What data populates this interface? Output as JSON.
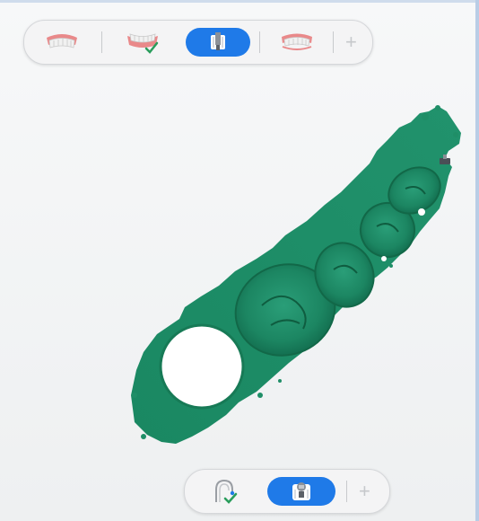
{
  "colors": {
    "accent": "#1f7ae8",
    "model": "#1f8e67",
    "toolbar_bg": "#f4f4f5",
    "check": "#2a9d5c"
  },
  "top_toolbar": {
    "buttons": [
      {
        "icon": "upper-jaw-teeth-icon",
        "active": false
      },
      {
        "icon": "lower-jaw-check-icon",
        "active": false
      },
      {
        "icon": "implant-scanbody-icon",
        "active": true
      },
      {
        "icon": "upper-jaw-preparation-icon",
        "active": false
      }
    ],
    "add_label": "+"
  },
  "bottom_toolbar": {
    "buttons": [
      {
        "icon": "arch-scan-check-icon",
        "active": false
      },
      {
        "icon": "scanbody-scan-icon",
        "active": true
      }
    ],
    "add_label": "+"
  }
}
